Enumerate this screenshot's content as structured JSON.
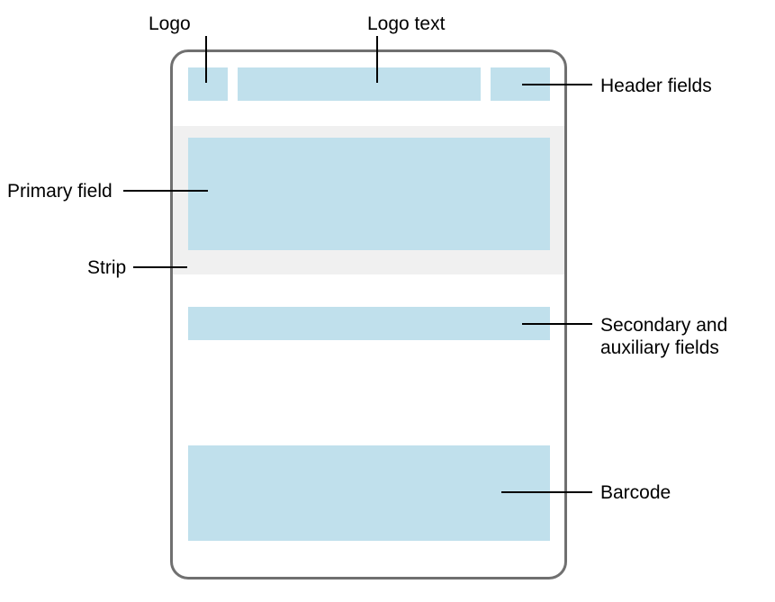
{
  "labels": {
    "logo": "Logo",
    "logo_text": "Logo text",
    "header_fields": "Header fields",
    "primary_field": "Primary field",
    "strip": "Strip",
    "secondary_aux": "Secondary and auxiliary fields",
    "barcode": "Barcode"
  },
  "diagram": {
    "regions": [
      "logo",
      "logo-text",
      "header-fields",
      "strip-bg",
      "primary-field",
      "secondary-aux",
      "barcode"
    ]
  },
  "colors": {
    "region_fill": "#c0e0ec",
    "strip_fill": "#f0f0f0",
    "card_border": "#707070"
  }
}
